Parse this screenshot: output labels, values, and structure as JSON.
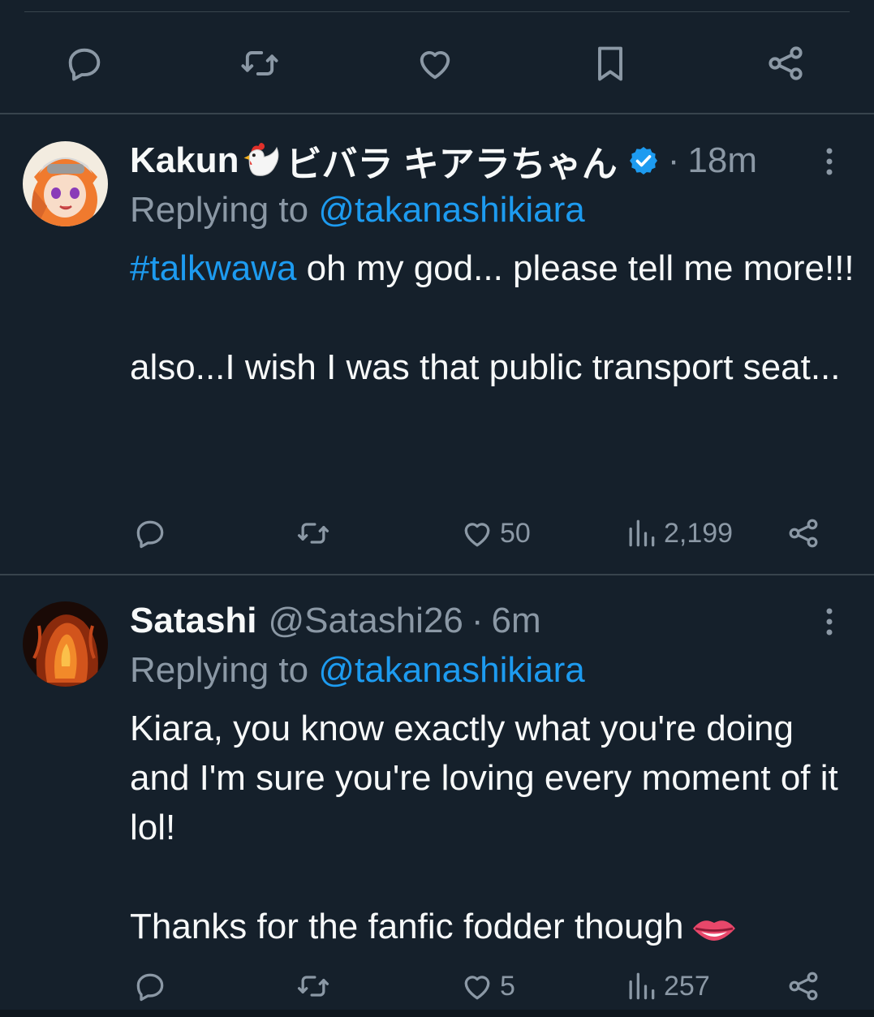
{
  "colors": {
    "background": "#15202b",
    "text": "#f7f9f9",
    "muted": "#8b98a5",
    "link": "#1d9bf0",
    "divider": "#38444d"
  },
  "main_actions": [
    "reply-icon",
    "retweet-icon",
    "like-icon",
    "bookmark-icon",
    "share-icon"
  ],
  "replies": [
    {
      "name": "Kakun",
      "name_suffix": "ビバラ キアラちゃん",
      "name_emoji": "chicken-emoji",
      "verified": true,
      "dot": "·",
      "time": "18m",
      "replying_label": "Replying to",
      "replying_mention": "@takanashikiara",
      "hashtag": "#talkwawa",
      "line1_rest": " oh my god... please tell me more!!!",
      "line2": "also...I wish I was that public transport seat...",
      "likes": "50",
      "views": "2,199"
    },
    {
      "name": "Satashi",
      "handle": "@Satashi26",
      "dot": "·",
      "time": "6m",
      "replying_label": "Replying to",
      "replying_mention": "@takanashikiara",
      "line1": "Kiara, you know exactly what you're doing and I'm sure you're loving every moment of it lol!",
      "line2": "Thanks for the fanfic fodder though",
      "line2_emoji": "lips-emoji",
      "likes": "5",
      "views": "257"
    }
  ]
}
